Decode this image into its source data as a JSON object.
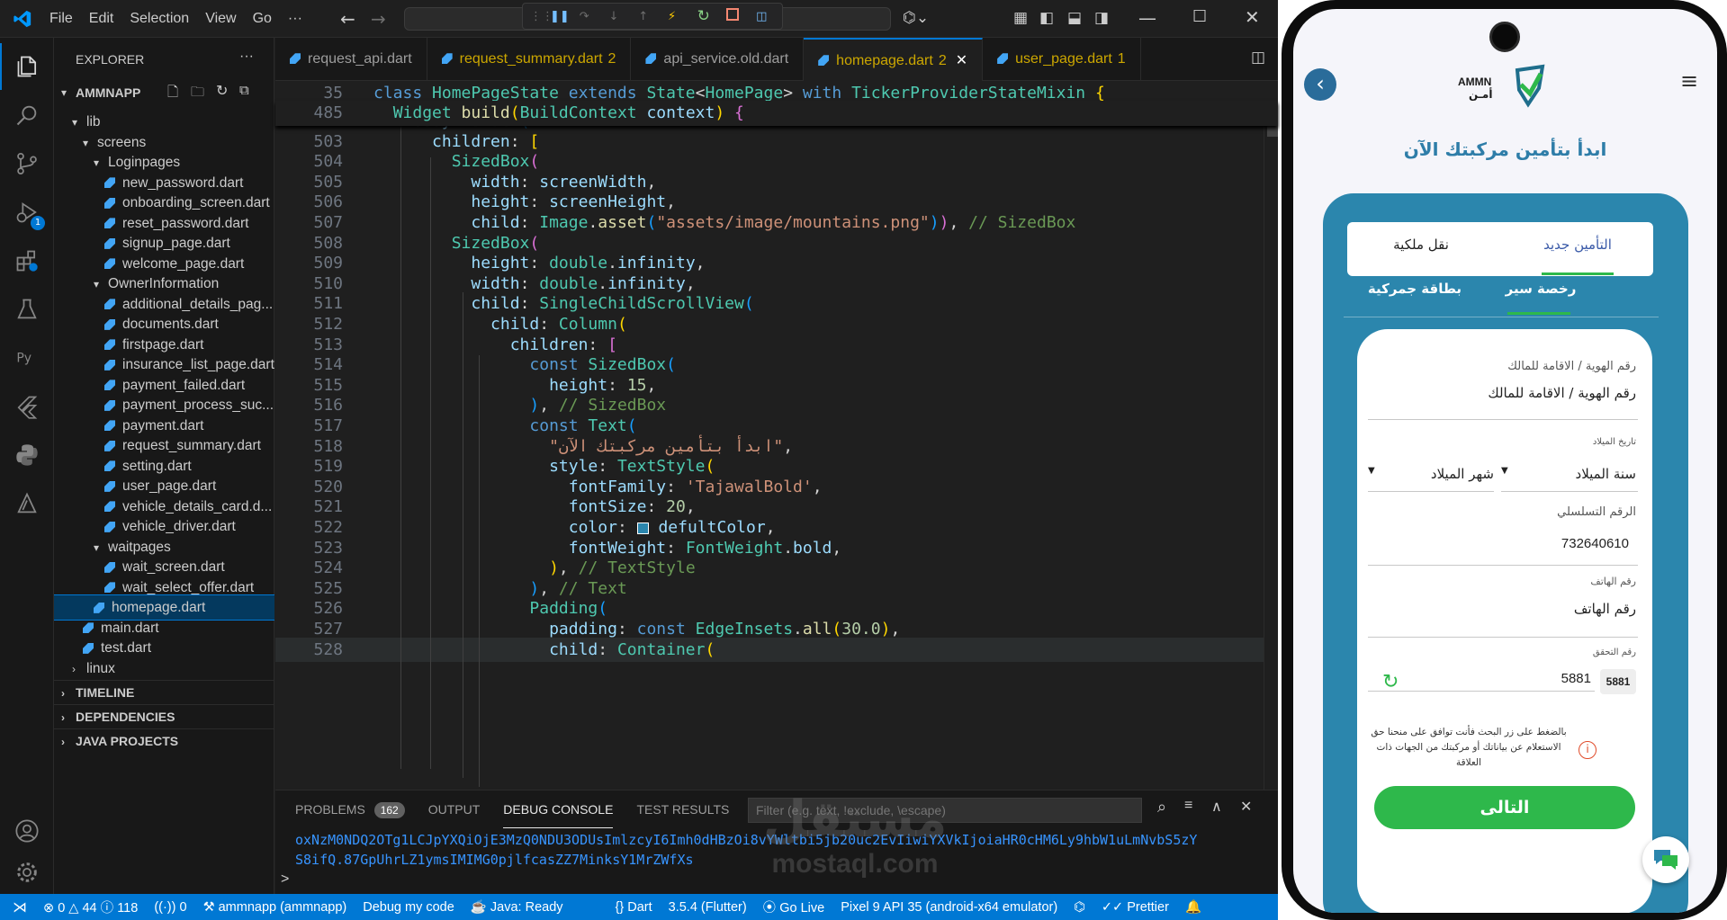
{
  "titlebar": {
    "menu": [
      "File",
      "Edit",
      "Selection",
      "View",
      "Go"
    ],
    "more": "···"
  },
  "sidebar": {
    "header": "EXPLORER",
    "more": "···",
    "project": "AMMNAPP",
    "items": [
      {
        "label": "lib",
        "indent": 1,
        "kind": "folder"
      },
      {
        "label": "screens",
        "indent": 2,
        "kind": "folder"
      },
      {
        "label": "Loginpages",
        "indent": 3,
        "kind": "folder"
      },
      {
        "label": "new_password.dart",
        "indent": 4,
        "kind": "file"
      },
      {
        "label": "onboarding_screen.dart",
        "indent": 4,
        "kind": "file"
      },
      {
        "label": "reset_password.dart",
        "indent": 4,
        "kind": "file"
      },
      {
        "label": "signup_page.dart",
        "indent": 4,
        "kind": "file"
      },
      {
        "label": "welcome_page.dart",
        "indent": 4,
        "kind": "file"
      },
      {
        "label": "OwnerInformation",
        "indent": 3,
        "kind": "folder"
      },
      {
        "label": "additional_details_pag...",
        "indent": 4,
        "kind": "file"
      },
      {
        "label": "documents.dart",
        "indent": 4,
        "kind": "file"
      },
      {
        "label": "firstpage.dart",
        "indent": 4,
        "kind": "file"
      },
      {
        "label": "insurance_list_page.dart",
        "indent": 4,
        "kind": "file"
      },
      {
        "label": "payment_failed.dart",
        "indent": 4,
        "kind": "file"
      },
      {
        "label": "payment_process_suc...",
        "indent": 4,
        "kind": "file"
      },
      {
        "label": "payment.dart",
        "indent": 4,
        "kind": "file"
      },
      {
        "label": "request_summary.dart",
        "indent": 4,
        "kind": "file"
      },
      {
        "label": "setting.dart",
        "indent": 4,
        "kind": "file"
      },
      {
        "label": "user_page.dart",
        "indent": 4,
        "kind": "file"
      },
      {
        "label": "vehicle_details_card.d...",
        "indent": 4,
        "kind": "file"
      },
      {
        "label": "vehicle_driver.dart",
        "indent": 4,
        "kind": "file"
      },
      {
        "label": "waitpages",
        "indent": 3,
        "kind": "folder"
      },
      {
        "label": "wait_screen.dart",
        "indent": 4,
        "kind": "file"
      },
      {
        "label": "wait_select_offer.dart",
        "indent": 4,
        "kind": "file"
      },
      {
        "label": "homepage.dart",
        "indent": 3,
        "kind": "file"
      },
      {
        "label": "main.dart",
        "indent": 2,
        "kind": "file"
      },
      {
        "label": "test.dart",
        "indent": 2,
        "kind": "file"
      },
      {
        "label": "linux",
        "indent": 1,
        "kind": "folder-closed"
      }
    ],
    "sections": [
      "TIMELINE",
      "DEPENDENCIES",
      "JAVA PROJECTS"
    ],
    "debug_badge": "1"
  },
  "tabs": [
    {
      "label": "request_api.dart",
      "mod": ""
    },
    {
      "label": "request_summary.dart",
      "mod": "2"
    },
    {
      "label": "api_service.old.dart",
      "mod": ""
    },
    {
      "label": "homepage.dart",
      "mod": "2"
    },
    {
      "label": "user_page.dart",
      "mod": "1"
    }
  ],
  "editor": {
    "sticky1_ln": "35",
    "sticky2_ln": "485",
    "line_numbers": [
      "503",
      "504",
      "505",
      "506",
      "507",
      "508",
      "509",
      "510",
      "511",
      "512",
      "513",
      "514",
      "515",
      "516",
      "517",
      "518",
      "519",
      "520",
      "521",
      "522",
      "523",
      "524",
      "525",
      "526",
      "527",
      "528"
    ],
    "str_mountains": "\"assets/image/mountains.png\"",
    "str_arabic": "\"ابدأ بتأمين مركبتك الآن\"",
    "str_font": "'TajawalBold'",
    "num_15": "15",
    "num_20": "20",
    "num_30": "30.0"
  },
  "panel": {
    "tabs": [
      "PROBLEMS",
      "OUTPUT",
      "DEBUG CONSOLE",
      "TEST RESULTS"
    ],
    "problems_count": "162",
    "filter_placeholder": "Filter (e.g. text, !exclude, \\escape)",
    "console_line1": "oxNzM0NDQ2OTg1LCJpYXQiOjE3MzQ0NDU3ODUsImlzcyI6Imh0dHBzOi8vYWltbi5jb20uc2EvIiwiYXVkIjoiaHR0cHM6Ly9hbW1uLmNvbS5zY",
    "console_line2": "S8ifQ.87GpUhrLZ1ymsIMIMG0pjlfcasZZ7MinksY1MrZWfXs",
    "prompt": ">"
  },
  "status": {
    "errors": "0",
    "warnings": "44",
    "info": "118",
    "ports": "0",
    "project": "ammnapp (ammnapp)",
    "debug": "Debug my code",
    "java": "Java: Ready",
    "lang": "Dart",
    "flutter": "3.5.4 (Flutter)",
    "golive": "Go Live",
    "device": "Pixel 9 API 35 (android-x64 emulator)",
    "prettier": "Prettier"
  },
  "watermark": {
    "line1": "مستقل",
    "line2": "mostaql.com"
  },
  "phone": {
    "logo_en": "AMMN",
    "logo_ar": "أمـن",
    "title": "ابدأ بتأمين مركبتك الآن",
    "tab_new": "التأمين جديد",
    "tab_transfer": "نقل ملكية",
    "sub_license": "رخصة سير",
    "sub_customs": "بطاقة جمركية",
    "id_label": "رقم الهوية / الاقامة للمالك",
    "id_placeholder": "رقم الهوية / الاقامة للمالك",
    "dob_label": "تاريخ الميلاد",
    "year_label": "سنة الميلاد",
    "month_label": "شهر الميلاد",
    "serial_label": "الرقم التسلسلي",
    "serial_value": "732640610",
    "phone_label": "رقم الهاتف",
    "phone_placeholder": "رقم الهاتف",
    "captcha_label": "رقم التحقق",
    "captcha_value": "5881",
    "captcha_badge": "5881",
    "consent": "بالضغط على زر البحث فأنت توافق على منحنا حق الاستعلام عن بياناتك أو مركبتك من الجهات ذات العلاقة",
    "next": "التالى"
  }
}
